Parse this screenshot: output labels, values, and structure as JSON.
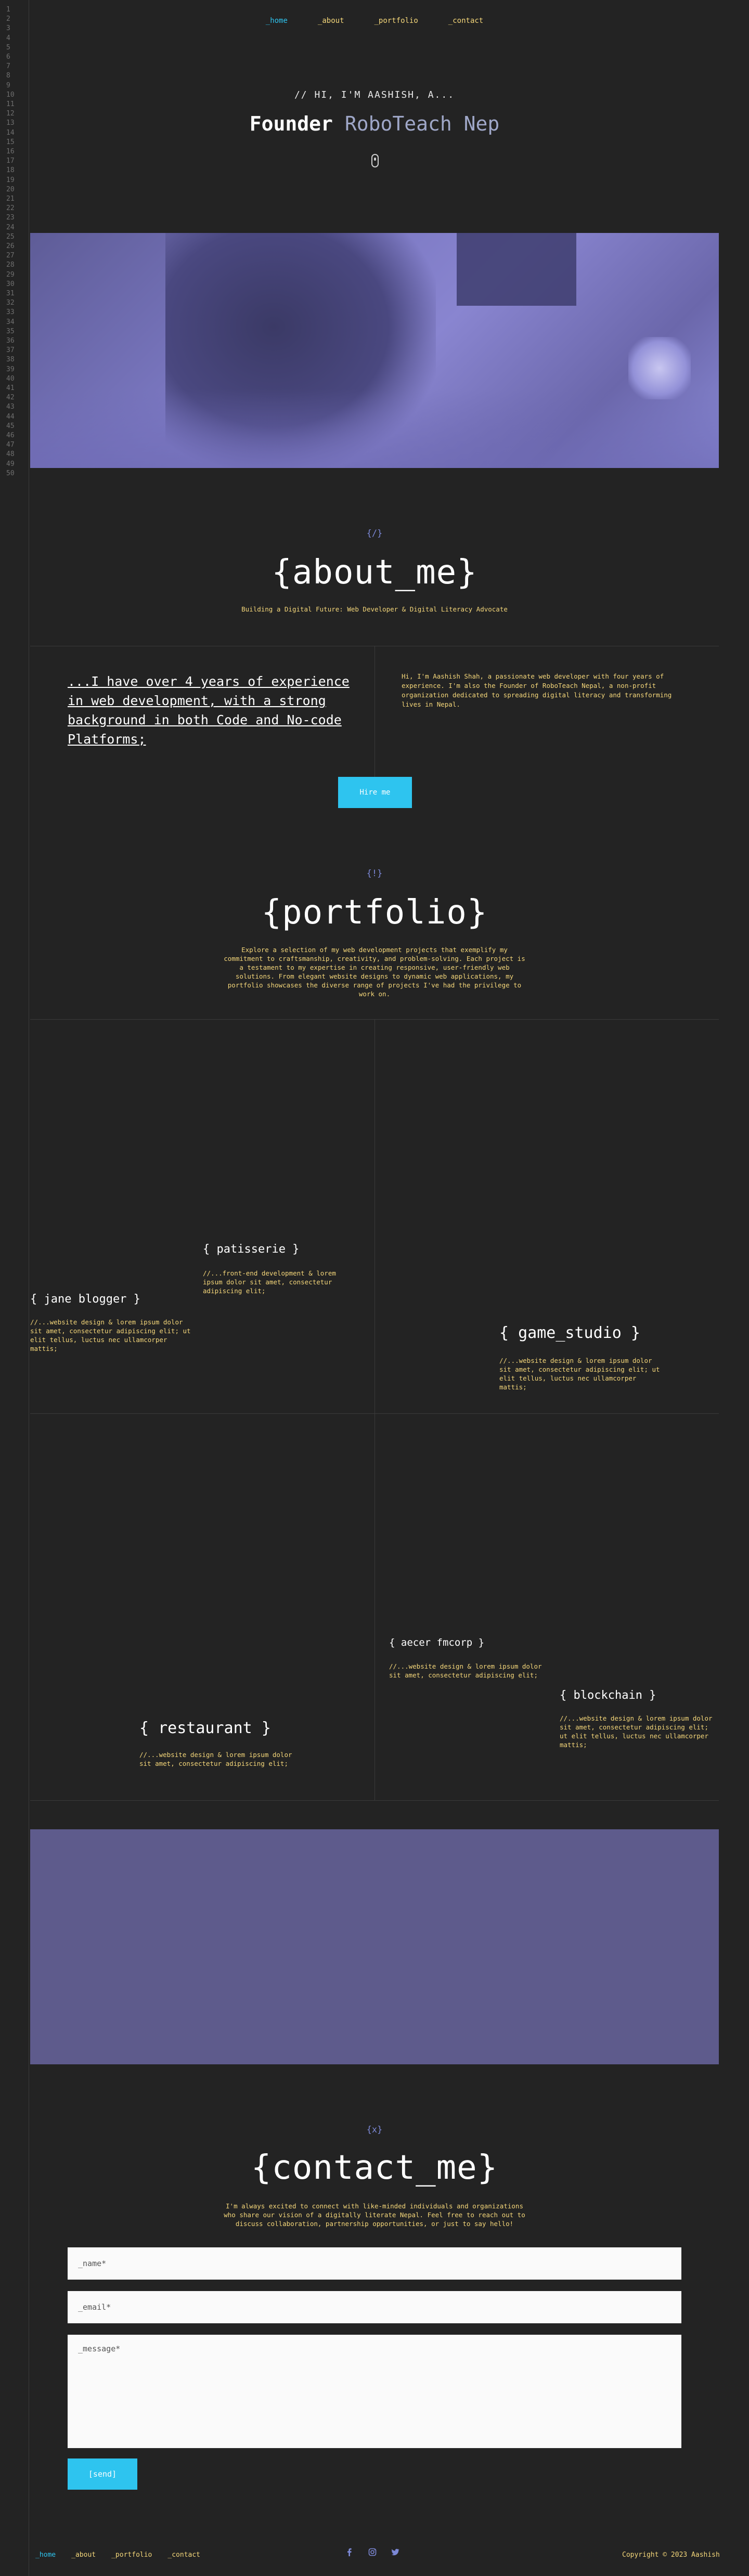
{
  "nav": {
    "items": [
      {
        "label": "_home",
        "active": true
      },
      {
        "label": "_about",
        "active": false
      },
      {
        "label": "_portfolio",
        "active": false
      },
      {
        "label": "_contact",
        "active": false
      }
    ]
  },
  "gutter": {
    "lines": [
      "1",
      "2",
      "3",
      "4",
      "5",
      "6",
      "7",
      "8",
      "9",
      "10",
      "11",
      "12",
      "13",
      "14",
      "15",
      "16",
      "17",
      "18",
      "19",
      "20",
      "21",
      "22",
      "23",
      "24",
      "25",
      "26",
      "27",
      "28",
      "29",
      "30",
      "31",
      "32",
      "33",
      "34",
      "35",
      "36",
      "37",
      "38",
      "39",
      "40",
      "41",
      "42",
      "43",
      "44",
      "45",
      "46",
      "47",
      "48",
      "49",
      "50"
    ]
  },
  "hero": {
    "eyebrow": "// HI, I'M AASHISH, A...",
    "title_main": "Founder",
    "title_accent": "RoboTeach Nep"
  },
  "about": {
    "icon": "{/}",
    "title": "{about_me}",
    "subtitle": "Building a Digital Future: Web Developer & Digital Literacy Advocate",
    "quote": "...I have over 4 years of experience in web development, with a strong background in both Code and No-code Platforms;",
    "text": "Hi, I'm Aashish Shah, a passionate web developer with four years of experience. I'm also the Founder of RoboTeach Nepal, a non-profit organization dedicated to spreading digital literacy and transforming lives in Nepal.",
    "hire_label": "Hire me"
  },
  "portfolio": {
    "icon": "{!}",
    "title": "{portfolio}",
    "description": "Explore a selection of my web development projects that exemplify my commitment to craftsmanship, creativity, and problem-solving. Each project is a testament to my expertise in creating responsive, user-friendly web solutions. From elegant website designs to dynamic web applications, my portfolio showcases the diverse range of projects I've had the privilege to work on.",
    "projects": [
      {
        "title": "{ patisserie }",
        "desc": "//...front-end development & lorem ipsum dolor sit amet, consectetur adipiscing elit;"
      },
      {
        "title": "{ jane blogger }",
        "desc": "//...website design & lorem ipsum dolor sit amet, consectetur adipiscing elit; ut elit tellus, luctus nec ullamcorper mattis;"
      },
      {
        "title": "{ game_studio }",
        "desc": "//...website design & lorem ipsum dolor sit amet, consectetur adipiscing elit; ut elit tellus, luctus nec ullamcorper mattis;"
      },
      {
        "title": "{ aecer fmcorp }",
        "desc": "//...website design & lorem ipsum dolor sit amet, consectetur adipiscing elit;"
      },
      {
        "title": "{ blockchain }",
        "desc": "//...website design & lorem ipsum dolor sit amet, consectetur adipiscing elit; ut elit tellus, luctus nec ullamcorper mattis;"
      },
      {
        "title": "{ restaurant }",
        "desc": "//...website design & lorem ipsum dolor sit amet, consectetur adipiscing elit;"
      }
    ]
  },
  "contact": {
    "icon": "{x}",
    "title": "{contact_me}",
    "description": "I'm always excited to connect with like-minded individuals and organizations who share our vision of a digitally literate Nepal. Feel free to reach out to discuss collaboration, partnership opportunities, or just to say hello!",
    "name_placeholder": "_name*",
    "email_placeholder": "_email*",
    "message_placeholder": "_message*",
    "send_label": "[send]"
  },
  "footer": {
    "items": [
      {
        "label": "_home",
        "active": true
      },
      {
        "label": "_about",
        "active": false
      },
      {
        "label": "_portfolio",
        "active": false
      },
      {
        "label": "_contact",
        "active": false
      }
    ],
    "social_icons": [
      "facebook-icon",
      "instagram-icon",
      "twitter-icon"
    ],
    "copyright": "Copyright © 2023 Aashish"
  },
  "colors": {
    "background": "#232323",
    "accent_cyan": "#2ec4ef",
    "accent_yellow": "#f5d77a",
    "accent_lavender": "#7c88d6",
    "image_tint": "#7b78c2"
  }
}
